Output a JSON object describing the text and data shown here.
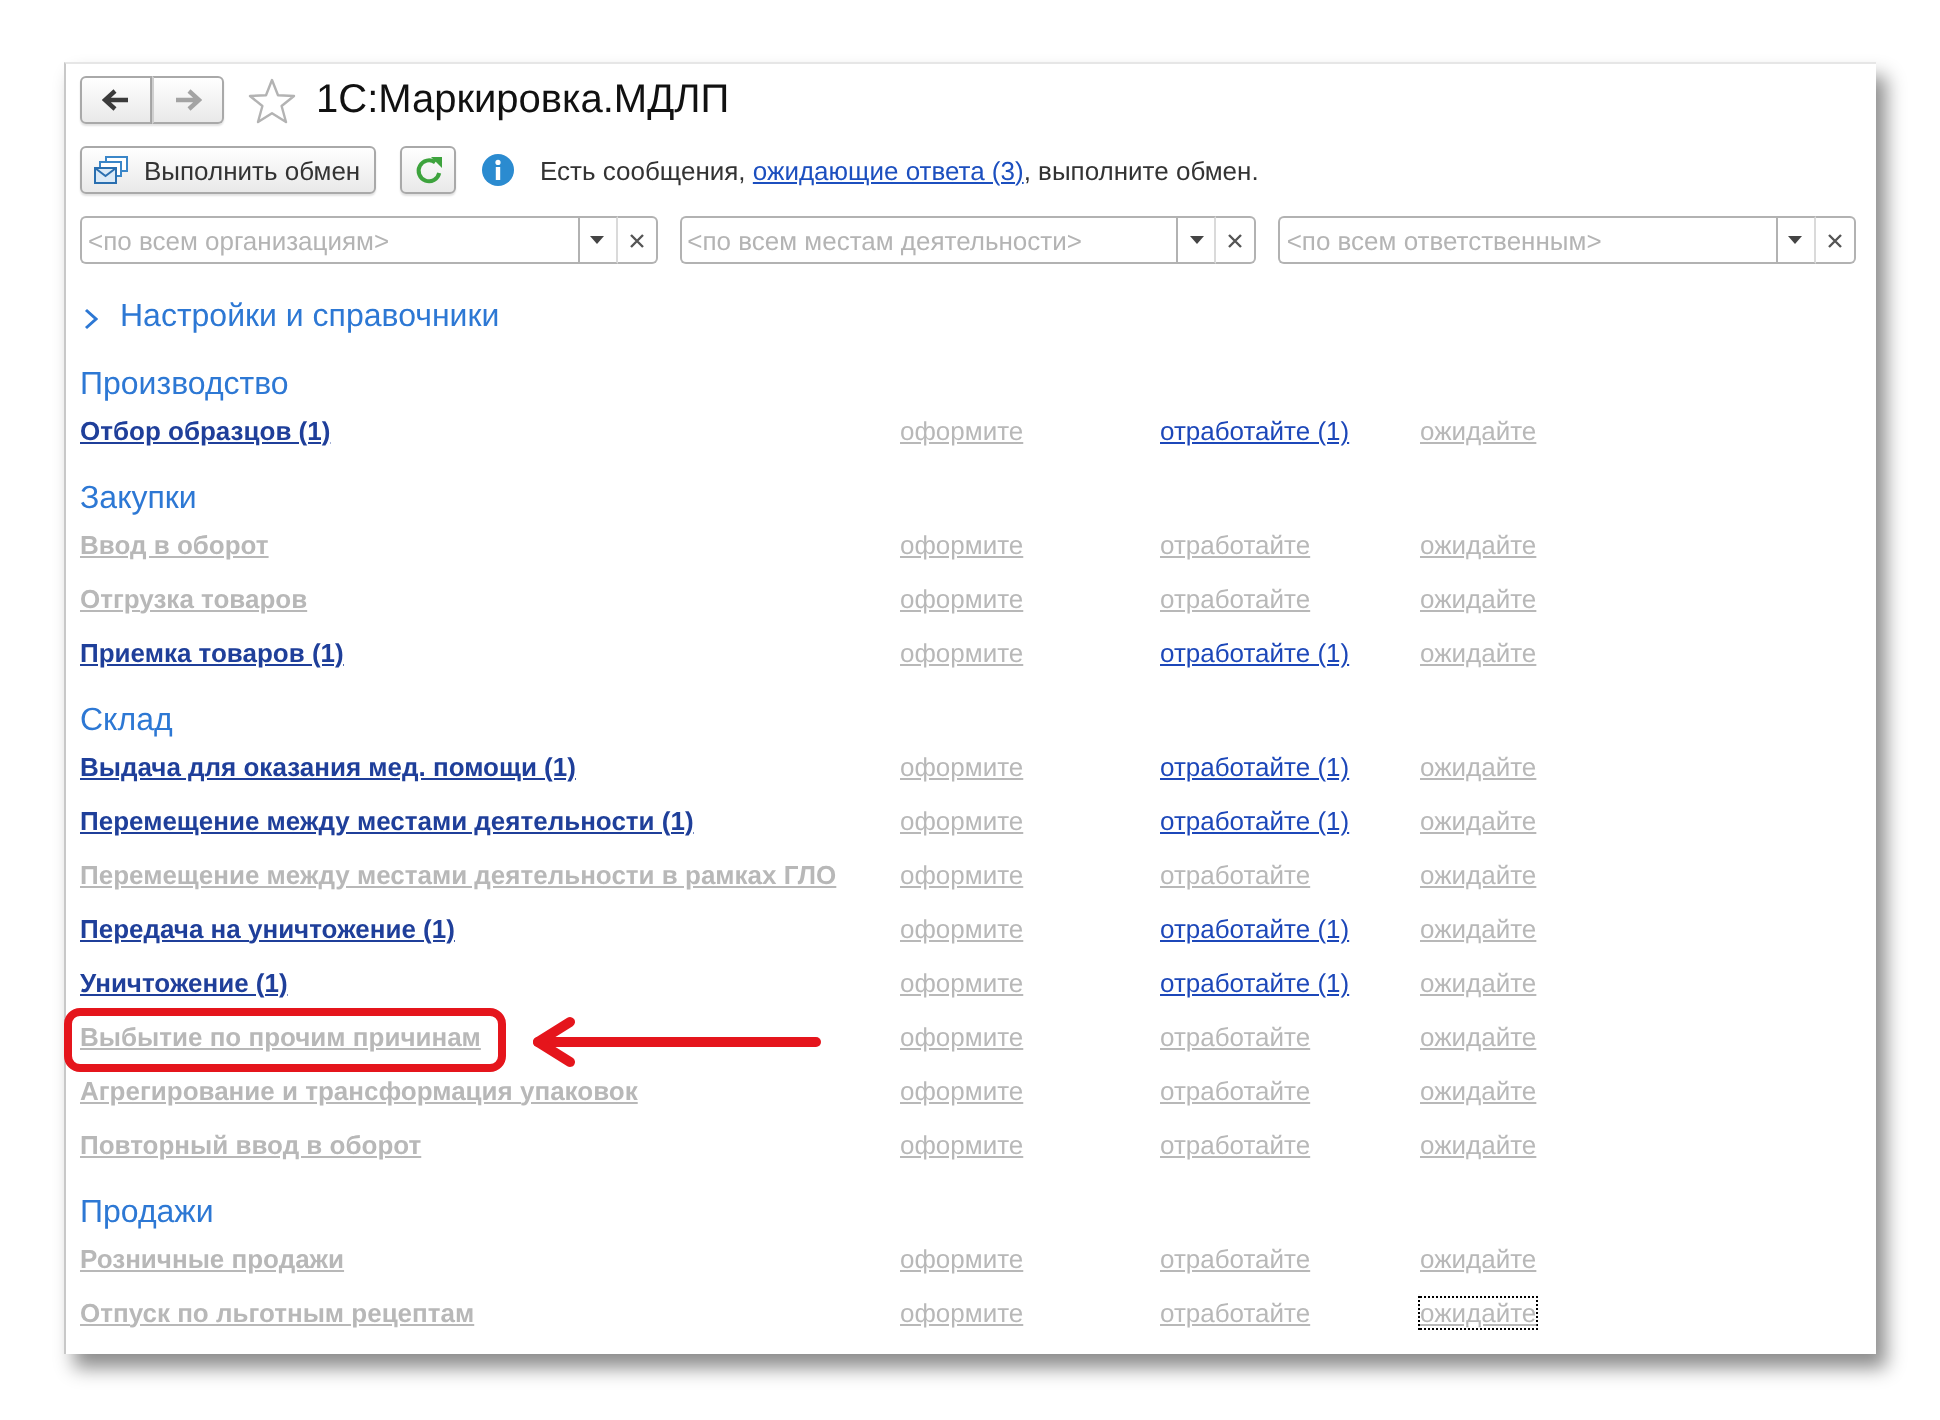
{
  "nav": {
    "back": {
      "disabled": false
    },
    "forward": {
      "disabled": true
    },
    "favorite": false,
    "title": "1С:Маркировка.МДЛП"
  },
  "exchange": {
    "button": "Выполнить обмен",
    "message": {
      "before": "Есть сообщения,",
      "link": "ожидающие ответа (3)",
      "after": ", выполните обмен."
    }
  },
  "filters": [
    {
      "placeholder": "<по всем организациям>"
    },
    {
      "placeholder": "<по всем местам деятельности>"
    },
    {
      "placeholder": "<по всем ответственным>"
    }
  ],
  "settings": {
    "label": "Настройки и справочники",
    "expanded": false
  },
  "sections": [
    {
      "title": "Производство",
      "items": [
        {
          "label": "Отбор образцов (1)",
          "active": true,
          "highlighted": false,
          "actions": [
            {
              "label": "оформите",
              "active": false,
              "focused": false
            },
            {
              "label": "отработайте (1)",
              "active": true,
              "focused": false
            },
            {
              "label": "ожидайте",
              "active": false,
              "focused": false
            }
          ]
        }
      ]
    },
    {
      "title": "Закупки",
      "items": [
        {
          "label": "Ввод в оборот",
          "active": false,
          "highlighted": false,
          "actions": [
            {
              "label": "оформите",
              "active": false,
              "focused": false
            },
            {
              "label": "отработайте",
              "active": false,
              "focused": false
            },
            {
              "label": "ожидайте",
              "active": false,
              "focused": false
            }
          ]
        },
        {
          "label": "Отгрузка товаров",
          "active": false,
          "highlighted": false,
          "actions": [
            {
              "label": "оформите",
              "active": false,
              "focused": false
            },
            {
              "label": "отработайте",
              "active": false,
              "focused": false
            },
            {
              "label": "ожидайте",
              "active": false,
              "focused": false
            }
          ]
        },
        {
          "label": "Приемка товаров (1)",
          "active": true,
          "highlighted": false,
          "actions": [
            {
              "label": "оформите",
              "active": false,
              "focused": false
            },
            {
              "label": "отработайте (1)",
              "active": true,
              "focused": false
            },
            {
              "label": "ожидайте",
              "active": false,
              "focused": false
            }
          ]
        }
      ]
    },
    {
      "title": "Склад",
      "items": [
        {
          "label": "Выдача для оказания мед. помощи (1)",
          "active": true,
          "highlighted": false,
          "actions": [
            {
              "label": "оформите",
              "active": false,
              "focused": false
            },
            {
              "label": "отработайте (1)",
              "active": true,
              "focused": false
            },
            {
              "label": "ожидайте",
              "active": false,
              "focused": false
            }
          ]
        },
        {
          "label": "Перемещение между местами деятельности (1)",
          "active": true,
          "highlighted": false,
          "actions": [
            {
              "label": "оформите",
              "active": false,
              "focused": false
            },
            {
              "label": "отработайте (1)",
              "active": true,
              "focused": false
            },
            {
              "label": "ожидайте",
              "active": false,
              "focused": false
            }
          ]
        },
        {
          "label": "Перемещение между местами деятельности в рамках ГЛО",
          "active": false,
          "highlighted": false,
          "actions": [
            {
              "label": "оформите",
              "active": false,
              "focused": false
            },
            {
              "label": "отработайте",
              "active": false,
              "focused": false
            },
            {
              "label": "ожидайте",
              "active": false,
              "focused": false
            }
          ]
        },
        {
          "label": "Передача на уничтожение (1)",
          "active": true,
          "highlighted": false,
          "actions": [
            {
              "label": "оформите",
              "active": false,
              "focused": false
            },
            {
              "label": "отработайте (1)",
              "active": true,
              "focused": false
            },
            {
              "label": "ожидайте",
              "active": false,
              "focused": false
            }
          ]
        },
        {
          "label": "Уничтожение (1)",
          "active": true,
          "highlighted": false,
          "actions": [
            {
              "label": "оформите",
              "active": false,
              "focused": false
            },
            {
              "label": "отработайте (1)",
              "active": true,
              "focused": false
            },
            {
              "label": "ожидайте",
              "active": false,
              "focused": false
            }
          ]
        },
        {
          "label": "Выбытие по прочим причинам",
          "active": false,
          "highlighted": true,
          "actions": [
            {
              "label": "оформите",
              "active": false,
              "focused": false
            },
            {
              "label": "отработайте",
              "active": false,
              "focused": false
            },
            {
              "label": "ожидайте",
              "active": false,
              "focused": false
            }
          ]
        },
        {
          "label": "Агрегирование и трансформация упаковок",
          "active": false,
          "highlighted": false,
          "actions": [
            {
              "label": "оформите",
              "active": false,
              "focused": false
            },
            {
              "label": "отработайте",
              "active": false,
              "focused": false
            },
            {
              "label": "ожидайте",
              "active": false,
              "focused": false
            }
          ]
        },
        {
          "label": "Повторный ввод в оборот",
          "active": false,
          "highlighted": false,
          "actions": [
            {
              "label": "оформите",
              "active": false,
              "focused": false
            },
            {
              "label": "отработайте",
              "active": false,
              "focused": false
            },
            {
              "label": "ожидайте",
              "active": false,
              "focused": false
            }
          ]
        }
      ]
    },
    {
      "title": "Продажи",
      "items": [
        {
          "label": "Розничные продажи",
          "active": false,
          "highlighted": false,
          "actions": [
            {
              "label": "оформите",
              "active": false,
              "focused": false
            },
            {
              "label": "отработайте",
              "active": false,
              "focused": false
            },
            {
              "label": "ожидайте",
              "active": false,
              "focused": false
            }
          ]
        },
        {
          "label": "Отпуск по льготным рецептам",
          "active": false,
          "highlighted": false,
          "actions": [
            {
              "label": "оформите",
              "active": false,
              "focused": false
            },
            {
              "label": "отработайте",
              "active": false,
              "focused": false
            },
            {
              "label": "ожидайте",
              "active": false,
              "focused": true
            }
          ]
        }
      ]
    }
  ]
}
